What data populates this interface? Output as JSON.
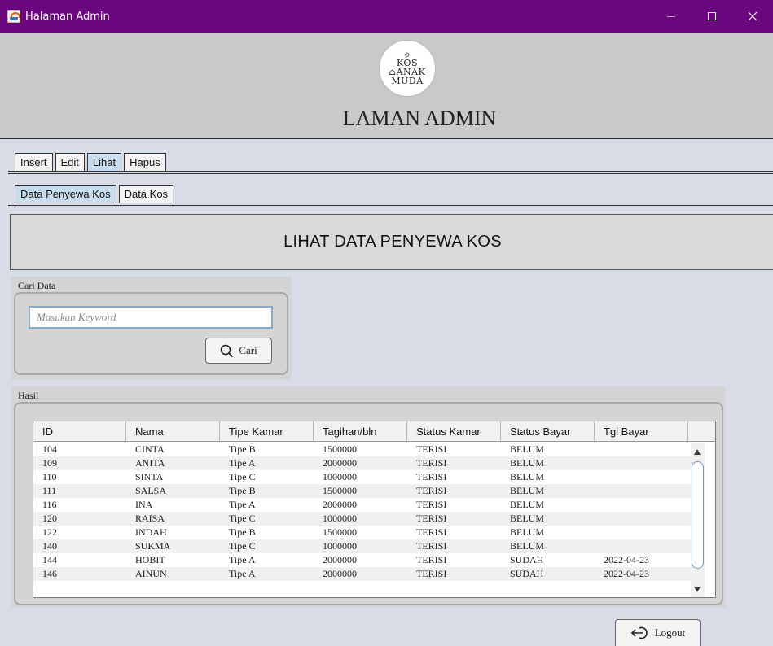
{
  "window": {
    "title": "Halaman Admin"
  },
  "header": {
    "logo": {
      "line1": "KOS",
      "line2": "ANAK",
      "line3": "MUDA"
    },
    "title": "LAMAN ADMIN"
  },
  "main_tabs": [
    "Insert",
    "Edit",
    "Lihat",
    "Hapus"
  ],
  "sub_tabs": [
    "Data Penyewa Kos",
    "Data Kos"
  ],
  "content_title": "LIHAT DATA PENYEWA KOS",
  "search": {
    "label": "Cari Data",
    "placeholder": "Masukan Keyword",
    "button": "Cari"
  },
  "result": {
    "label": "Hasil",
    "columns": [
      "ID",
      "Nama",
      "Tipe Kamar",
      "Tagihan/bln",
      "Status Kamar",
      "Status Bayar",
      "Tgl Bayar"
    ],
    "rows": [
      [
        "104",
        "CINTA",
        "Tipe B",
        "1500000",
        "TERISI",
        "BELUM",
        ""
      ],
      [
        "109",
        "ANITA",
        "Tipe A",
        "2000000",
        "TERISI",
        "BELUM",
        ""
      ],
      [
        "110",
        "SINTA",
        "Tipe C",
        "1000000",
        "TERISI",
        "BELUM",
        ""
      ],
      [
        "111",
        "SALSA",
        "Tipe B",
        "1500000",
        "TERISI",
        "BELUM",
        ""
      ],
      [
        "116",
        "INA",
        "Tipe A",
        "2000000",
        "TERISI",
        "BELUM",
        ""
      ],
      [
        "120",
        "RAISA",
        "Tipe C",
        "1000000",
        "TERISI",
        "BELUM",
        ""
      ],
      [
        "122",
        "INDAH",
        "Tipe B",
        "1500000",
        "TERISI",
        "BELUM",
        ""
      ],
      [
        "140",
        "SUKMA",
        "Tipe C",
        "1000000",
        "TERISI",
        "BELUM",
        ""
      ],
      [
        "144",
        "HOBIT",
        "Tipe A",
        "2000000",
        "TERISI",
        "SUDAH",
        "2022-04-23"
      ],
      [
        "146",
        "AINUN",
        "Tipe A",
        "2000000",
        "TERISI",
        "SUDAH",
        "2022-04-23"
      ]
    ]
  },
  "logout_button": "Logout",
  "colors": {
    "titlebar": "#6b077e",
    "active_tab": "#c7dcef",
    "background": "#d8dce6"
  },
  "icons": [
    "app-icon",
    "minimize-icon",
    "maximize-icon",
    "close-icon",
    "search-icon",
    "logout-icon"
  ]
}
